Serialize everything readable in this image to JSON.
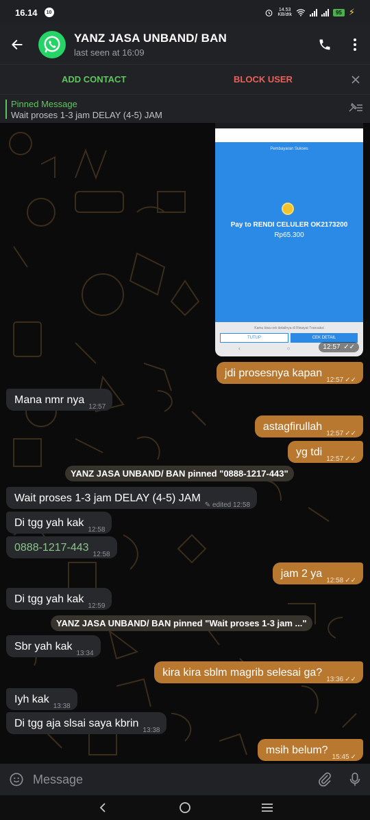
{
  "status": {
    "time": "16.14",
    "notif": "10",
    "speed_top": "14.53",
    "speed_bottom": "KB/dtk",
    "battery": "95"
  },
  "header": {
    "title": "YANZ JASA UNBAND/ BAN",
    "subtitle": "last seen at 16:09"
  },
  "actionbar": {
    "add_contact": "ADD CONTACT",
    "block_user": "BLOCK USER"
  },
  "pinned": {
    "label": "Pinned Message",
    "text": "Wait proses 1-3 jam DELAY (4-5) JAM"
  },
  "image_message": {
    "subtitle": "Pembayaran Sukses",
    "pay_title": "Pay to RENDI CELULER OK2173200",
    "amount": "Rp65.300",
    "note": "Kamu bisa cek detailnya di Riwayat Transaksi",
    "btn_close": "TUTUP",
    "btn_detail": "CEK DETAIL",
    "time": "12:57",
    "ticks": "✓✓"
  },
  "messages": [
    {
      "text": "jdi prosesnya kapan",
      "time": "12:57",
      "ticks": "✓✓"
    },
    {
      "text": "Mana nmr nya",
      "time": "12:57"
    },
    {
      "text": "astagfirullah",
      "time": "12:57",
      "ticks": "✓✓"
    },
    {
      "text": "yg tdi",
      "time": "12:57",
      "ticks": "✓✓"
    },
    {
      "service": "YANZ JASA UNBAND/ BAN pinned \"0888-1217-443\""
    },
    {
      "text": "Wait proses 1-3 jam DELAY (4-5) JAM",
      "time": "edited 12:58"
    },
    {
      "text": "Di tgg yah kak",
      "time": "12:58"
    },
    {
      "text": "0888-1217-443",
      "time": "12:58"
    },
    {
      "text": "jam 2 ya",
      "time": "12:58",
      "ticks": "✓✓"
    },
    {
      "text": "Di tgg yah kak",
      "time": "12:59"
    },
    {
      "service": "YANZ JASA UNBAND/ BAN pinned \"Wait proses 1-3 jam ...\""
    },
    {
      "text": "Sbr yah kak",
      "time": "13:34"
    },
    {
      "text": "kira kira sblm magrib selesai ga?",
      "time": "13:36",
      "ticks": "✓✓"
    },
    {
      "text": "Iyh kak",
      "time": "13:38"
    },
    {
      "text": "Di tgg aja slsai saya kbrin",
      "time": "13:38"
    },
    {
      "text": "msih belum?",
      "time": "15:45",
      "ticks": "✓"
    }
  ],
  "composer": {
    "placeholder": "Message"
  },
  "colors": {
    "accent_green": "#5fc65f",
    "block_red": "#e8615a",
    "outgoing": "#b9782f",
    "incoming": "#28292d"
  }
}
